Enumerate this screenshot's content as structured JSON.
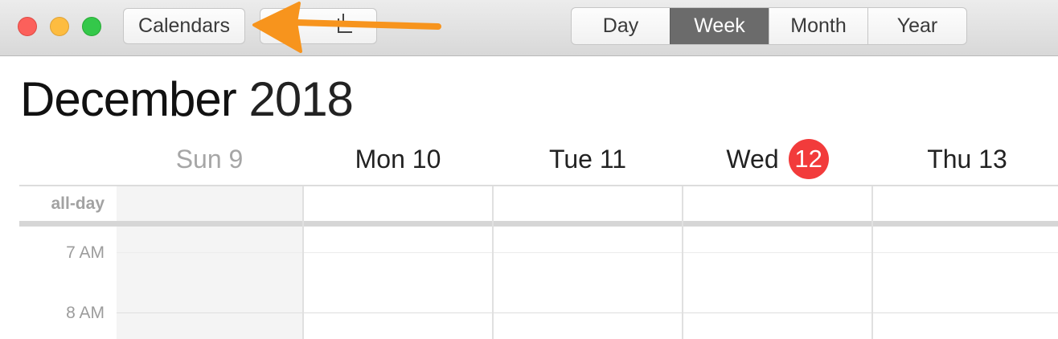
{
  "toolbar": {
    "calendars_label": "Calendars",
    "view_modes": [
      "Day",
      "Week",
      "Month",
      "Year"
    ],
    "active_view": "Week",
    "annotation_arrow_color": "#f7941d"
  },
  "header": {
    "month": "December",
    "year": "2018"
  },
  "days": [
    {
      "label": "Sun 9",
      "muted": true
    },
    {
      "label": "Mon 10"
    },
    {
      "label": "Tue 11"
    },
    {
      "label": "Wed",
      "today_number": "12"
    },
    {
      "label": "Thu 13"
    }
  ],
  "grid": {
    "allday_label": "all-day",
    "hours": [
      "7 AM",
      "8 AM"
    ]
  },
  "colors": {
    "today_badge": "#f23b3b",
    "active_segment": "#6b6b6b"
  }
}
